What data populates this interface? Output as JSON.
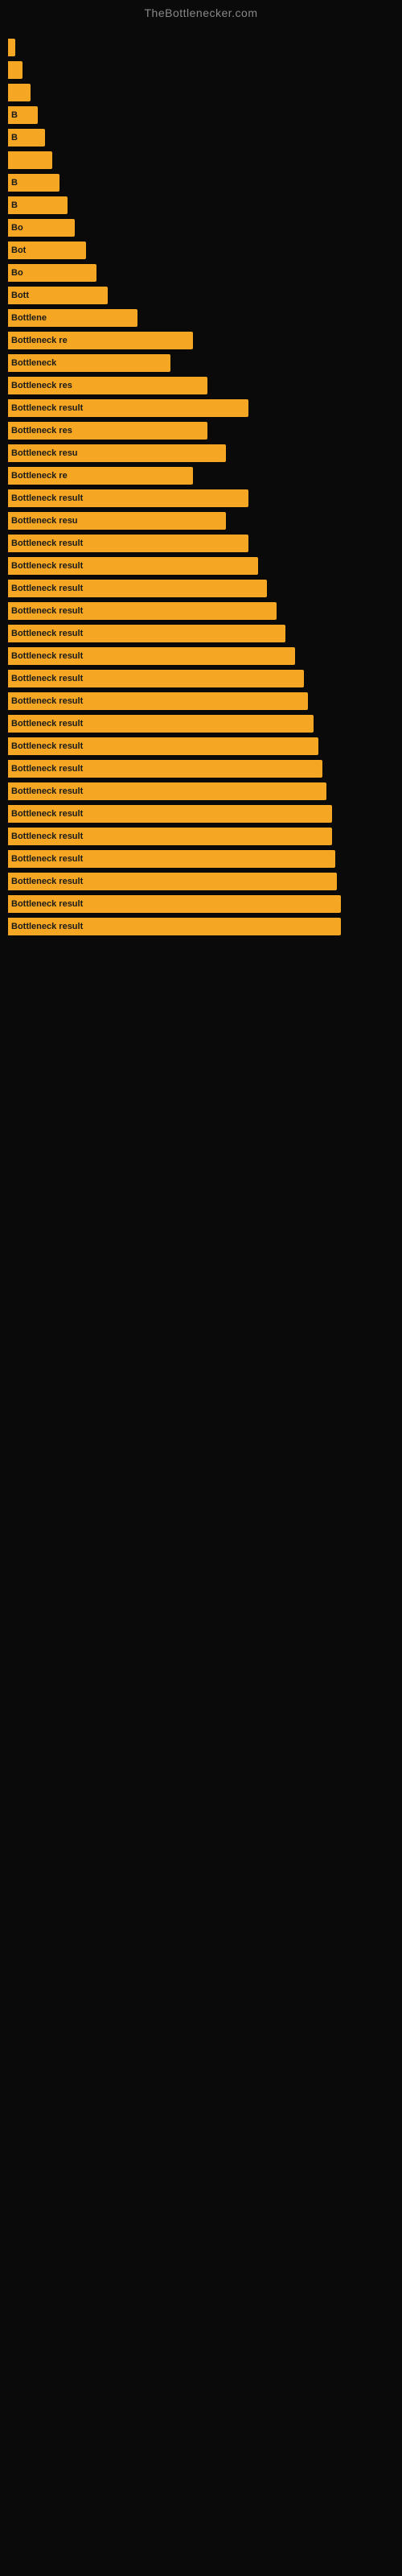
{
  "site": {
    "title": "TheBottlenecker.com"
  },
  "bars": [
    {
      "label": "",
      "width": 4
    },
    {
      "label": "",
      "width": 8
    },
    {
      "label": "",
      "width": 12
    },
    {
      "label": "B",
      "width": 16
    },
    {
      "label": "B",
      "width": 20
    },
    {
      "label": "",
      "width": 24
    },
    {
      "label": "B",
      "width": 28
    },
    {
      "label": "B",
      "width": 32
    },
    {
      "label": "Bo",
      "width": 36
    },
    {
      "label": "Bot",
      "width": 42
    },
    {
      "label": "Bo",
      "width": 48
    },
    {
      "label": "Bott",
      "width": 54
    },
    {
      "label": "Bottlene",
      "width": 70
    },
    {
      "label": "Bottleneck re",
      "width": 100
    },
    {
      "label": "Bottleneck",
      "width": 88
    },
    {
      "label": "Bottleneck res",
      "width": 108
    },
    {
      "label": "Bottleneck result",
      "width": 130
    },
    {
      "label": "Bottleneck res",
      "width": 108
    },
    {
      "label": "Bottleneck resu",
      "width": 118
    },
    {
      "label": "Bottleneck re",
      "width": 100
    },
    {
      "label": "Bottleneck result",
      "width": 130
    },
    {
      "label": "Bottleneck resu",
      "width": 118
    },
    {
      "label": "Bottleneck result",
      "width": 130
    },
    {
      "label": "Bottleneck result",
      "width": 135
    },
    {
      "label": "Bottleneck result",
      "width": 140
    },
    {
      "label": "Bottleneck result",
      "width": 145
    },
    {
      "label": "Bottleneck result",
      "width": 150
    },
    {
      "label": "Bottleneck result",
      "width": 155
    },
    {
      "label": "Bottleneck result",
      "width": 160
    },
    {
      "label": "Bottleneck result",
      "width": 162
    },
    {
      "label": "Bottleneck result",
      "width": 165
    },
    {
      "label": "Bottleneck result",
      "width": 168
    },
    {
      "label": "Bottleneck result",
      "width": 170
    },
    {
      "label": "Bottleneck result",
      "width": 172
    },
    {
      "label": "Bottleneck result",
      "width": 175
    },
    {
      "label": "Bottleneck result",
      "width": 175
    },
    {
      "label": "Bottleneck result",
      "width": 177
    },
    {
      "label": "Bottleneck result",
      "width": 178
    },
    {
      "label": "Bottleneck result",
      "width": 180
    },
    {
      "label": "Bottleneck result",
      "width": 180
    }
  ]
}
